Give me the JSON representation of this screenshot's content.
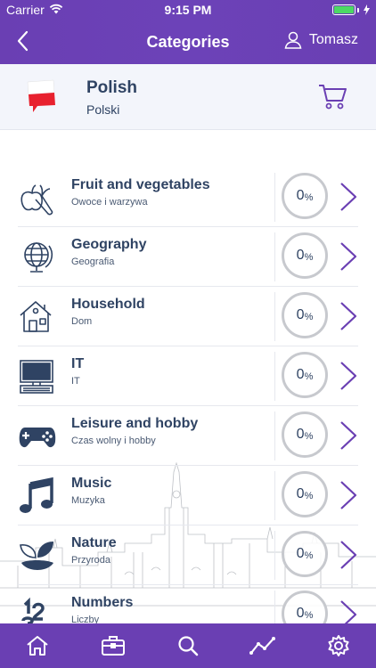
{
  "status_bar": {
    "carrier": "Carrier",
    "time": "9:15 PM"
  },
  "nav": {
    "title": "Categories",
    "user_name": "Tomasz"
  },
  "language": {
    "name": "Polish",
    "native": "Polski"
  },
  "categories": [
    {
      "title": "Fruit and vegetables",
      "subtitle": "Owoce i warzywa",
      "progress": "0",
      "icon": "fruit-vegetables-icon"
    },
    {
      "title": "Geography",
      "subtitle": "Geografia",
      "progress": "0",
      "icon": "globe-icon"
    },
    {
      "title": "Household",
      "subtitle": "Dom",
      "progress": "0",
      "icon": "house-icon"
    },
    {
      "title": "IT",
      "subtitle": "IT",
      "progress": "0",
      "icon": "computer-icon"
    },
    {
      "title": "Leisure and hobby",
      "subtitle": "Czas wolny i hobby",
      "progress": "0",
      "icon": "gamepad-icon"
    },
    {
      "title": "Music",
      "subtitle": "Muzyka",
      "progress": "0",
      "icon": "music-note-icon"
    },
    {
      "title": "Nature",
      "subtitle": "Przyroda",
      "progress": "0",
      "icon": "leaves-icon"
    },
    {
      "title": "Numbers",
      "subtitle": "Liczby",
      "progress": "0",
      "icon": "numbers-icon"
    }
  ],
  "progress_unit": "%",
  "tabs": [
    "home-icon",
    "briefcase-icon",
    "search-icon",
    "stats-icon",
    "gear-icon"
  ],
  "colors": {
    "accent": "#6a3fb3",
    "text": "#2f4363",
    "chevron": "#6a3fb3"
  }
}
